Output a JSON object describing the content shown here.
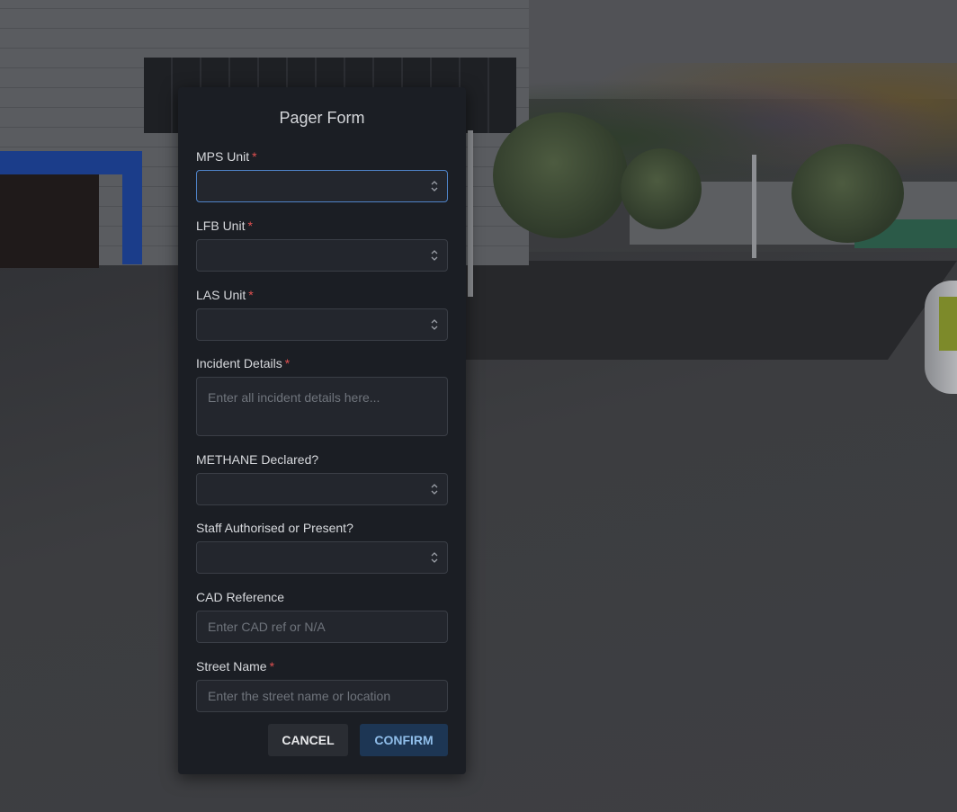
{
  "form": {
    "title": "Pager Form",
    "required_marker": "*",
    "fields": {
      "mps_unit": {
        "label": "MPS Unit",
        "value": ""
      },
      "lfb_unit": {
        "label": "LFB Unit",
        "value": ""
      },
      "las_unit": {
        "label": "LAS Unit",
        "value": ""
      },
      "incident_details": {
        "label": "Incident Details",
        "value": "",
        "placeholder": "Enter all incident details here..."
      },
      "methane_declared": {
        "label": "METHANE Declared?",
        "value": ""
      },
      "staff_authorised": {
        "label": "Staff Authorised or Present?",
        "value": ""
      },
      "cad_reference": {
        "label": "CAD Reference",
        "value": "",
        "placeholder": "Enter CAD ref or N/A"
      },
      "street_name": {
        "label": "Street Name",
        "value": "",
        "placeholder": "Enter the street name or location"
      }
    },
    "buttons": {
      "cancel": "CANCEL",
      "confirm": "CONFIRM"
    }
  },
  "colors": {
    "modal_background": "#1b1e24",
    "required": "#e05050",
    "focus_border": "#4f83c8",
    "confirm_background": "#1d3654",
    "confirm_text": "#8fbde9"
  },
  "icons": {
    "select_chevron": "chevron-up-down-icon"
  }
}
